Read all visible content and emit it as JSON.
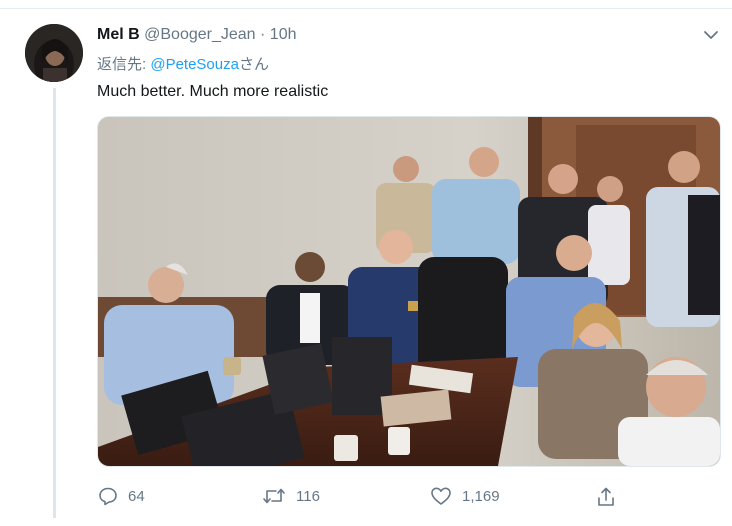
{
  "tweet": {
    "author_name": "Mel B",
    "author_handle": "@Booger_Jean",
    "separator": "·",
    "time": "10h",
    "reply_prefix": "返信先: ",
    "reply_mention": "@PeteSouza",
    "reply_suffix": "さん",
    "text": "Much better. Much more realistic"
  },
  "actions": {
    "reply_count": "64",
    "retweet_count": "116",
    "like_count": "1,169"
  },
  "icons": {
    "menu": "chevron-down-icon",
    "reply": "reply-icon",
    "retweet": "retweet-icon",
    "like": "heart-icon",
    "share": "share-icon"
  },
  "colors": {
    "accent": "#1da1f2",
    "secondary_text": "#657786",
    "text": "#14171a"
  }
}
